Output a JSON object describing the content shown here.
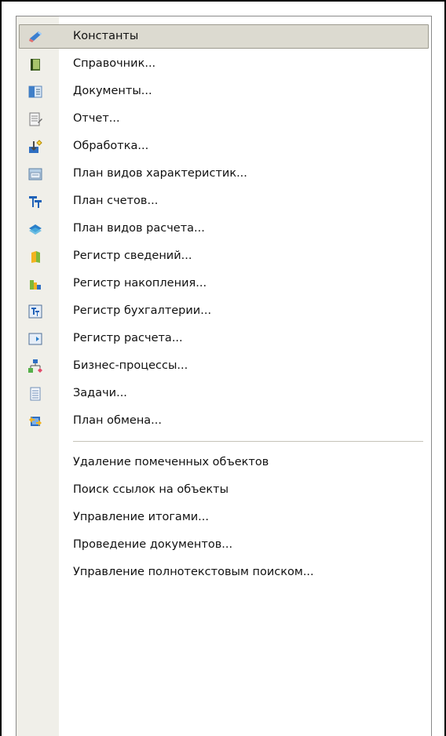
{
  "menu": {
    "items": [
      {
        "label": "Константы",
        "icon": "constants-icon",
        "highlighted": true
      },
      {
        "label": "Справочник...",
        "icon": "catalog-icon"
      },
      {
        "label": "Документы...",
        "icon": "documents-icon"
      },
      {
        "label": "Отчет...",
        "icon": "report-icon"
      },
      {
        "label": "Обработка...",
        "icon": "data-processor-icon"
      },
      {
        "label": "План видов характеристик...",
        "icon": "characteristic-types-icon"
      },
      {
        "label": "План счетов...",
        "icon": "chart-of-accounts-icon"
      },
      {
        "label": "План видов расчета...",
        "icon": "calculation-types-icon"
      },
      {
        "label": "Регистр сведений...",
        "icon": "information-register-icon"
      },
      {
        "label": "Регистр накопления...",
        "icon": "accumulation-register-icon"
      },
      {
        "label": "Регистр бухгалтерии...",
        "icon": "accounting-register-icon"
      },
      {
        "label": "Регистр расчета...",
        "icon": "calculation-register-icon"
      },
      {
        "label": "Бизнес-процессы...",
        "icon": "business-process-icon"
      },
      {
        "label": "Задачи...",
        "icon": "tasks-icon"
      },
      {
        "label": "План обмена...",
        "icon": "exchange-plan-icon"
      }
    ],
    "service_items": [
      {
        "label": "Удаление помеченных объектов"
      },
      {
        "label": "Поиск ссылок на объекты"
      },
      {
        "label": "Управление итогами..."
      },
      {
        "label": "Проведение документов..."
      },
      {
        "label": "Управление полнотекстовым поиском..."
      }
    ]
  }
}
